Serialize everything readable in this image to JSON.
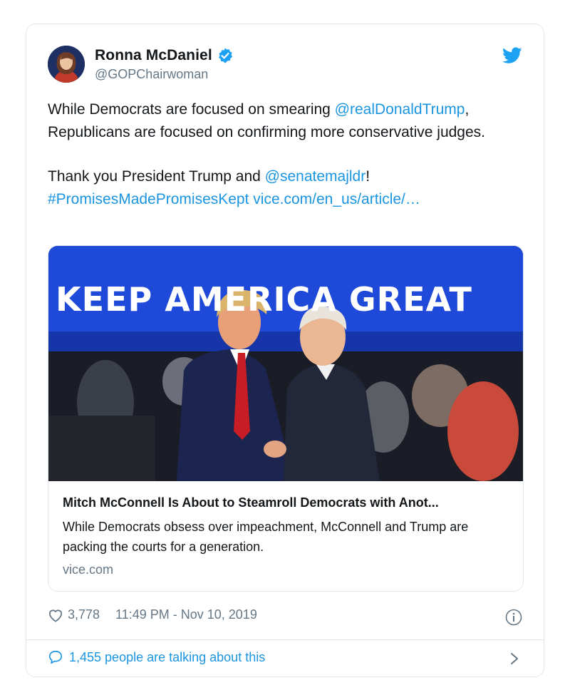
{
  "author": {
    "display_name": "Ronna McDaniel",
    "handle": "@GOPChairwoman"
  },
  "tweet": {
    "p1_before": "While Democrats are focused on smearing ",
    "p1_mention": "@realDonaldTrump",
    "p1_after": ", Republicans are focused on confirming more conservative judges.",
    "p2_before": "Thank you President Trump and ",
    "p2_mention": "@senatemajldr",
    "p2_after": "!",
    "hashtag": "#PromisesMadePromisesKept",
    "url": "vice.com/en_us/article/…"
  },
  "link_card": {
    "banner_text": "KEEP AMERICA GREAT",
    "title": "Mitch McConnell Is About to Steamroll Democrats with Anot...",
    "description": "While Democrats obsess over impeachment, McConnell and Trump are packing the courts for a generation.",
    "domain": "vice.com"
  },
  "stats": {
    "likes": "3,778",
    "timestamp": "11:49 PM - Nov 10, 2019"
  },
  "footer": {
    "talking": "1,455 people are talking about this"
  },
  "colors": {
    "link": "#1b95e0",
    "text": "#14171a",
    "muted": "#657786",
    "border": "#e1e8ed",
    "banner": "#1f49d9"
  },
  "icons": [
    "verified-badge-icon",
    "twitter-bird-icon",
    "heart-icon",
    "info-icon",
    "reply-bubble-icon",
    "chevron-right-icon"
  ]
}
